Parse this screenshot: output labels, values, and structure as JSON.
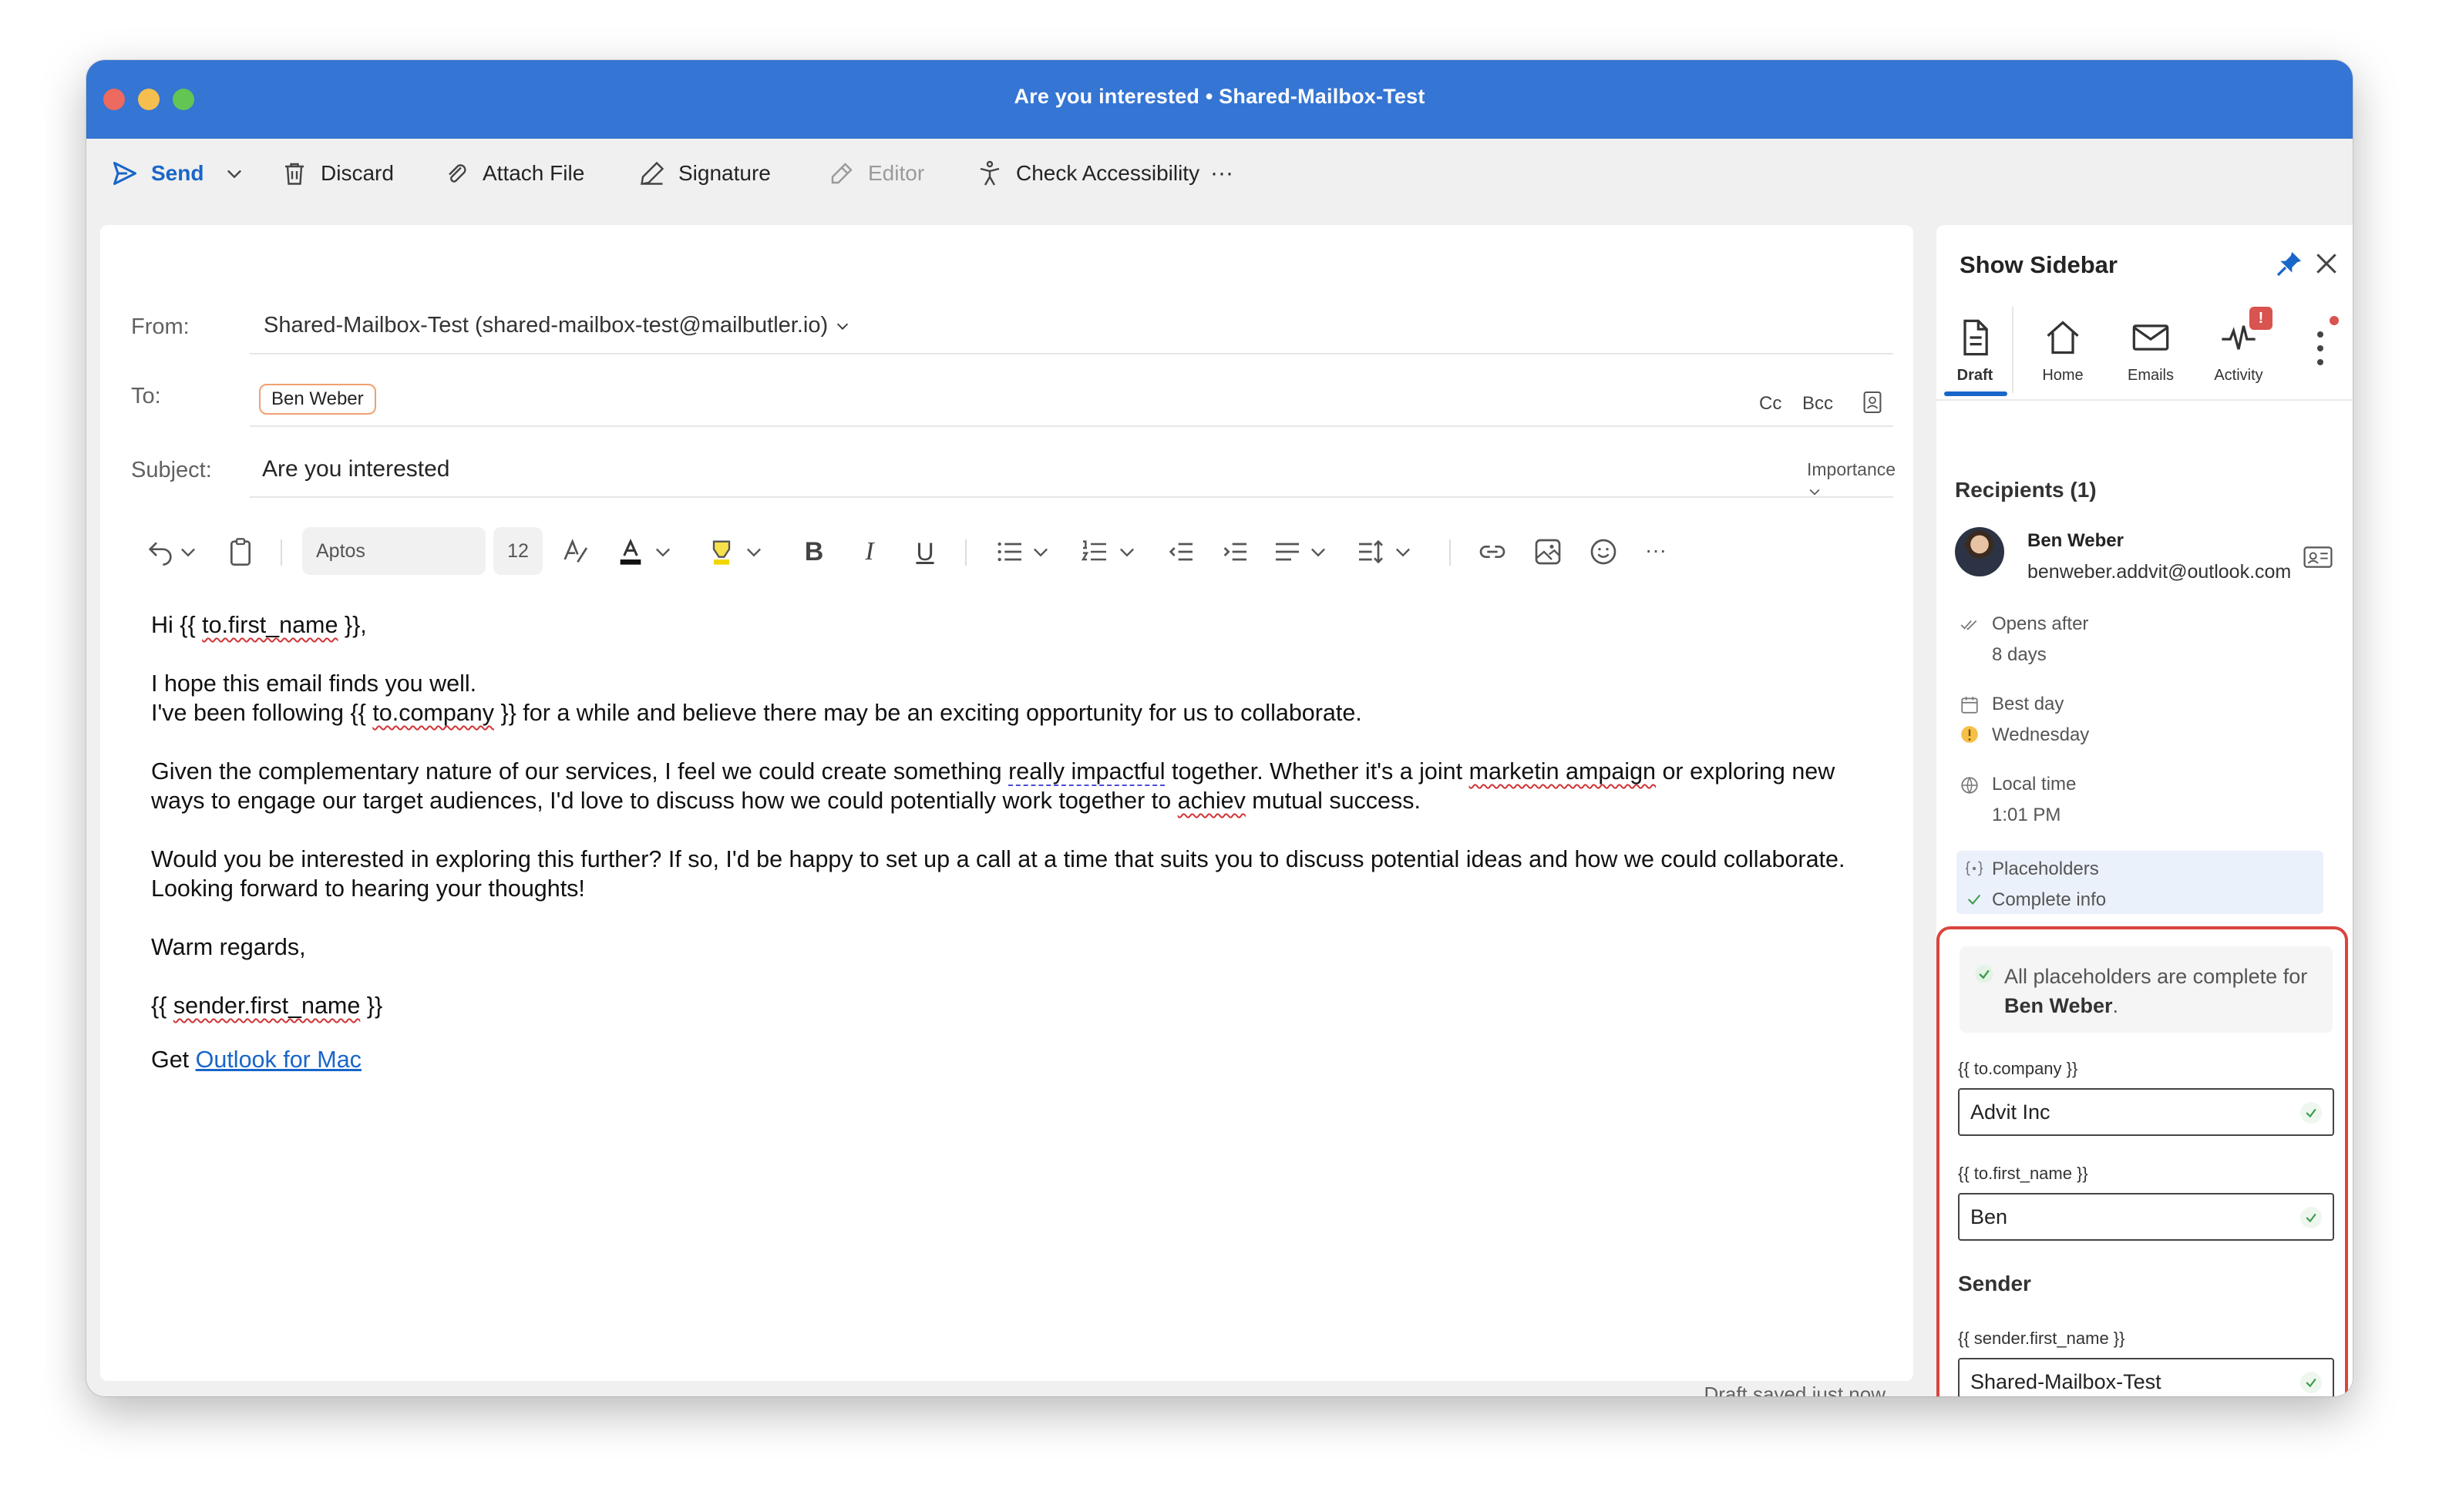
{
  "window": {
    "title": "Are you interested • Shared-Mailbox-Test"
  },
  "toolbar": {
    "send": "Send",
    "discard": "Discard",
    "attach": "Attach File",
    "signature": "Signature",
    "editor": "Editor",
    "accessibility": "Check Accessibility",
    "more": "···"
  },
  "compose": {
    "from_label": "From:",
    "from_value": "Shared-Mailbox-Test (shared-mailbox-test@mailbutler.io)",
    "to_label": "To:",
    "to_recipient": "Ben Weber",
    "cc": "Cc",
    "bcc": "Bcc",
    "subject_label": "Subject:",
    "subject_value": "Are you interested",
    "importance": "Importance",
    "font_name": "Aptos",
    "font_size": "12",
    "body": {
      "greet_pre": "Hi {{ ",
      "greet_sq": "to.first_name",
      "greet_post": " }},",
      "l1": "I hope this email finds you well.",
      "l2_pre": "I've been following {{ ",
      "l2_sq": "to.company",
      "l2_post": " }} for a while and believe there may be an exciting opportunity for us to collaborate.",
      "p2_a": "Given the complementary nature of our services, I feel we could create something ",
      "p2_b": "really impactful",
      "p2_c": " together. Whether it's a joint ",
      "p2_d": "marketin ampaign",
      "p2_e": " or exploring new",
      "p2_f": "ways to engage our target audiences, I'd love to discuss how we could potentially work together to ",
      "p2_g": "achiev",
      "p2_h": " mutual success.",
      "p3_1": "Would you be interested in exploring this further? If so, I'd be happy to set up a call at a time that suits you to discuss potential ideas and how we could collaborate.",
      "p3_2": "Looking forward to hearing your thoughts!",
      "closing": "Warm regards,",
      "sig_pre": "{{ ",
      "sig_sq": "sender.first_name",
      "sig_post": " }}",
      "get": "Get ",
      "get_link": "Outlook for Mac"
    },
    "draft_status": "Draft saved just now"
  },
  "sidebar": {
    "title": "Show Sidebar",
    "tabs": [
      "Draft",
      "Home",
      "Emails",
      "Activity"
    ],
    "activity_badge": "!",
    "recipients_header": "Recipients (1)",
    "recipient_name": "Ben Weber",
    "recipient_email": "benweber.addvit@outlook.com",
    "opens_after": "Opens after",
    "opens_after_val": "8 days",
    "best_day": "Best day",
    "best_day_val": "Wednesday",
    "local_time": "Local time",
    "local_time_val": "1:01 PM",
    "placeholders": "Placeholders",
    "complete_info": "Complete info",
    "notice_pre": "All placeholders are complete for",
    "notice_name": "Ben Weber",
    "notice_post": ".",
    "ph1_label": "{{ to.company }}",
    "ph1_value": "Advit Inc",
    "ph2_label": "{{ to.first_name }}",
    "ph2_value": "Ben",
    "sender_header": "Sender",
    "ph3_label": "{{ sender.first_name }}",
    "ph3_value": "Shared-Mailbox-Test"
  }
}
